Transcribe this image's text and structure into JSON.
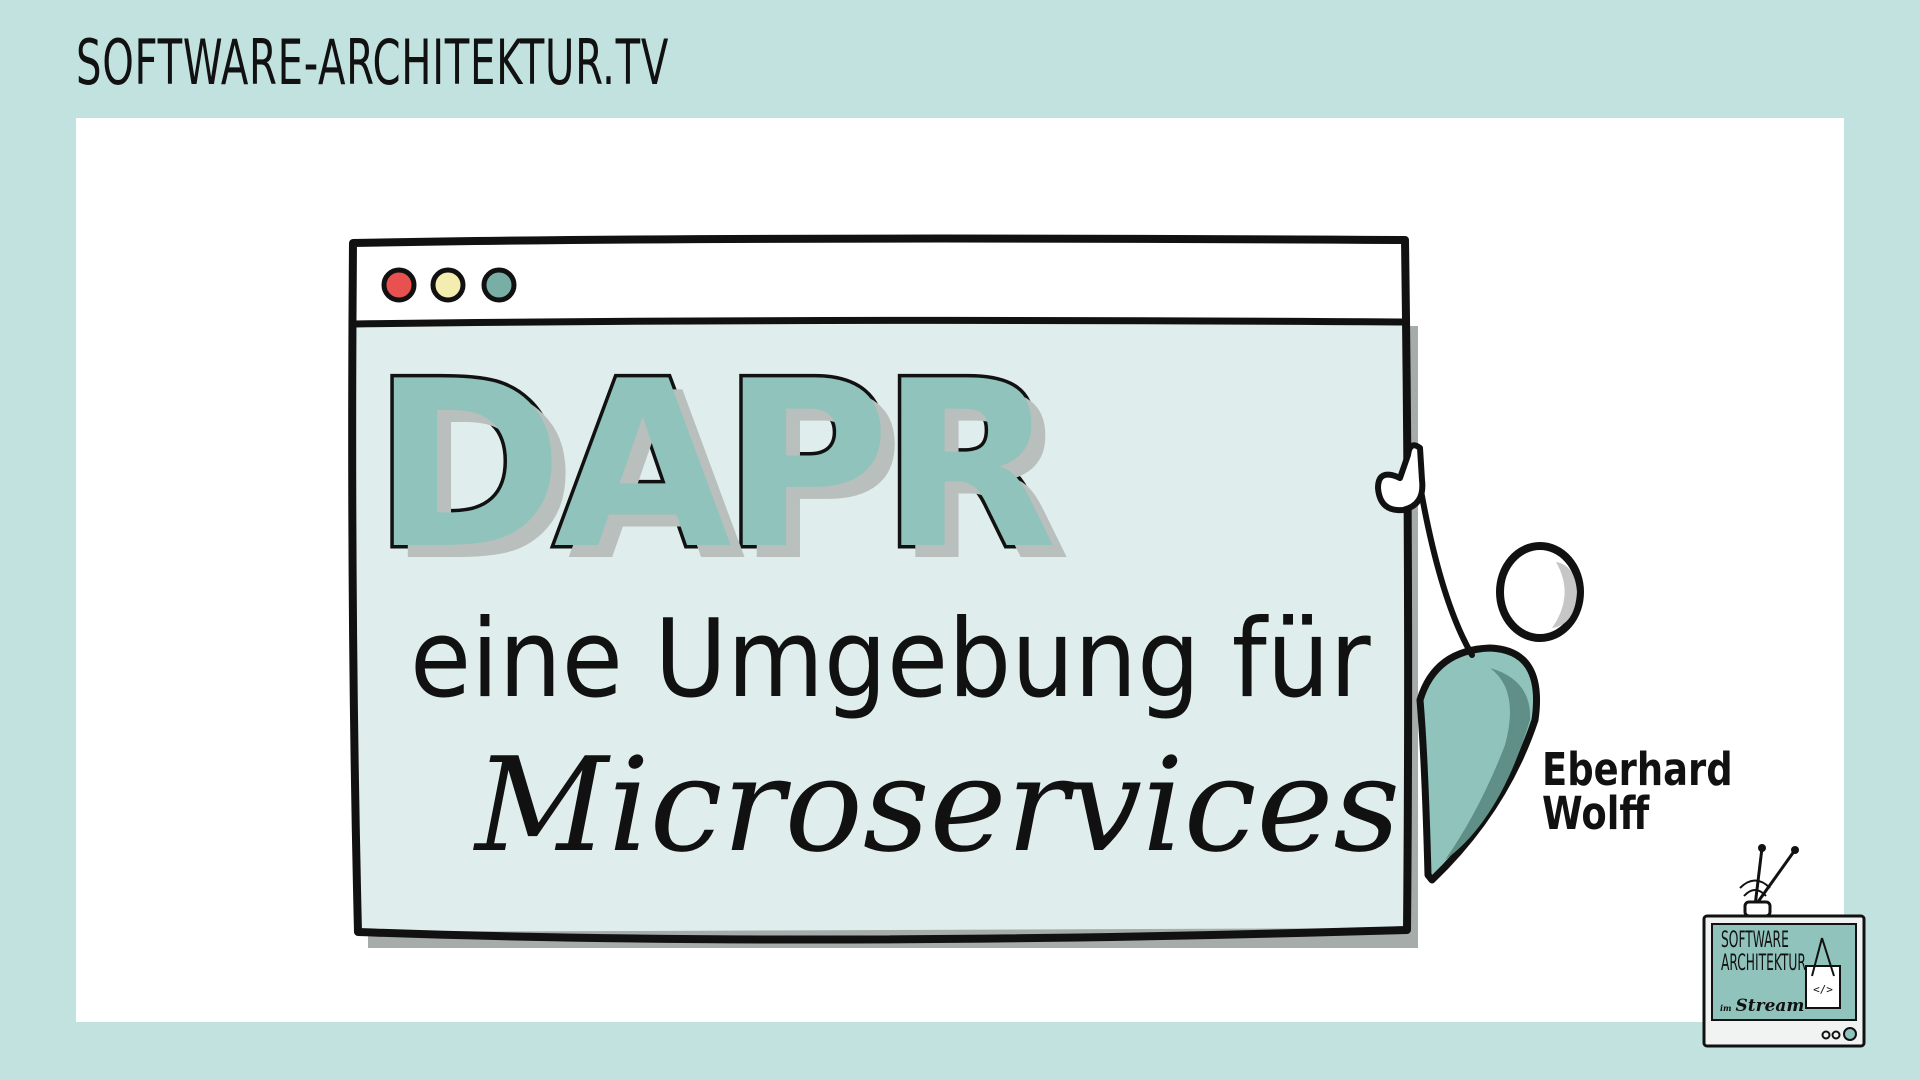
{
  "header": {
    "site_name": "SOFTWARE-ARCHITEKTUR.TV"
  },
  "title": {
    "main": "DAPR",
    "subtitle": "eine Umgebung für",
    "topic": "Microservices"
  },
  "speaker": {
    "first_name": "Eberhard",
    "last_name": "Wolff"
  },
  "logo": {
    "line1": "SOFTWARE",
    "line2": "ARCHITEKTUR",
    "prefix": "im",
    "stream": "Stream",
    "code_glyph": "</>"
  },
  "colors": {
    "background": "#c1e2de",
    "window_body": "#dfeeec",
    "accent_teal": "#8fc3bb",
    "dot_red": "#e8514f",
    "dot_yellow": "#f3eeb0",
    "dot_teal": "#79aea6"
  }
}
